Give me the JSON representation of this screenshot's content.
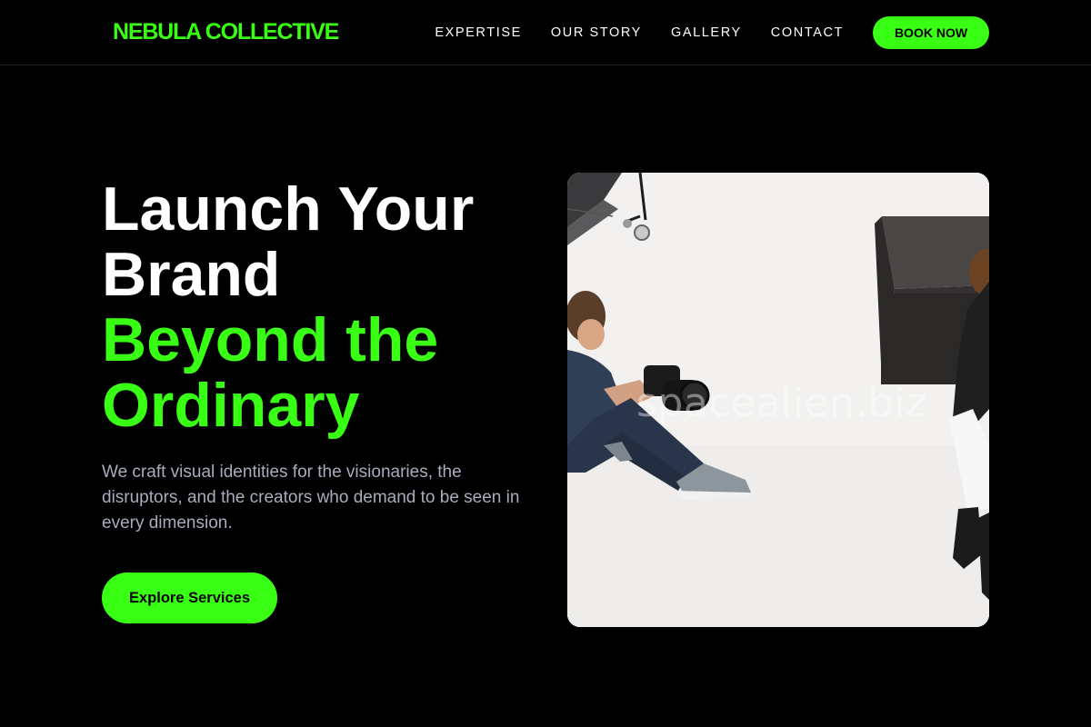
{
  "brand": {
    "name": "NEBULA COLLECTIVE",
    "accent_color": "#39ff14"
  },
  "nav": {
    "links": [
      "EXPERTISE",
      "OUR STORY",
      "GALLERY",
      "CONTACT"
    ],
    "cta": "BOOK NOW"
  },
  "hero": {
    "headline_line1": "Launch Your",
    "headline_line2": "Brand",
    "headline_accent_line1": "Beyond the",
    "headline_accent_line2": "Ordinary",
    "description": "We craft visual identities for the visionaries, the disruptors, and the creators who demand to be seen in every dimension.",
    "cta": "Explore Services"
  },
  "image": {
    "subject": "photographer-studio-photo",
    "watermark": "spacealien.biz"
  }
}
